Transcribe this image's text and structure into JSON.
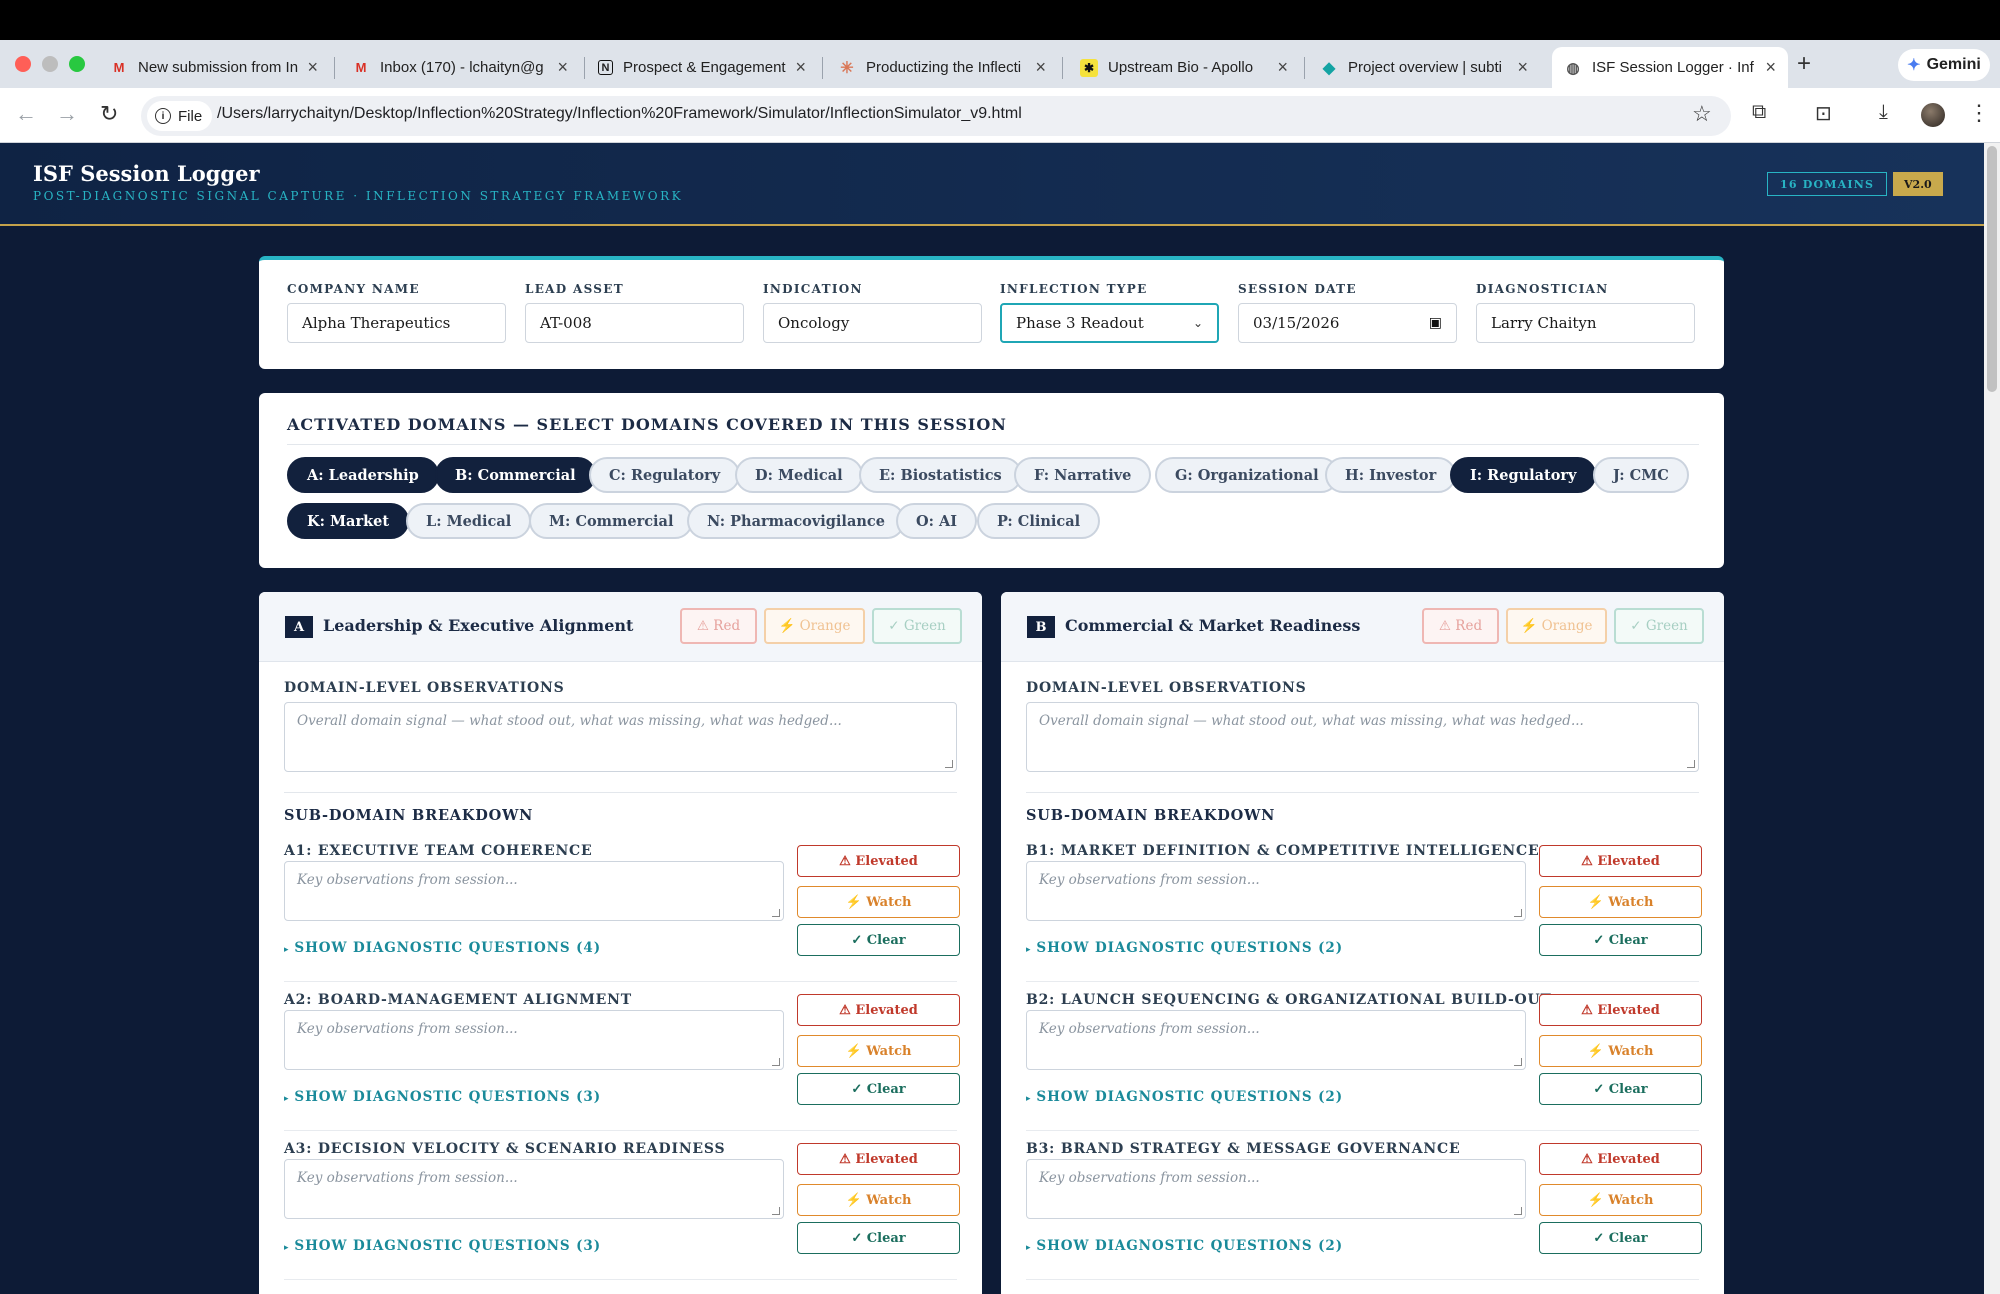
{
  "browser": {
    "tabs": [
      {
        "title": "New submission from In",
        "icon": "gmail-icon"
      },
      {
        "title": "Inbox (170) - lchaityn@g",
        "icon": "gmail-icon"
      },
      {
        "title": "Prospect & Engagement",
        "icon": "notion-icon"
      },
      {
        "title": "Productizing the Inflecti",
        "icon": "claude-icon"
      },
      {
        "title": "Upstream Bio - Apollo",
        "icon": "apollo-icon"
      },
      {
        "title": "Project overview | subti",
        "icon": "diamond-icon"
      },
      {
        "title": "ISF Session Logger · Inf",
        "icon": "globe-icon",
        "active": true
      }
    ],
    "gemini_label": "Gemini",
    "file_chip": "File",
    "url": "/Users/larrychaityn/Desktop/Inflection%20Strategy/Inflection%20Framework/Simulator/InflectionSimulator_v9.html"
  },
  "header": {
    "title": "ISF Session Logger",
    "subtitle": "POST-DIAGNOSTIC SIGNAL CAPTURE · INFLECTION STRATEGY FRAMEWORK",
    "domains_badge": "16 DOMAINS",
    "version_badge": "V2.0"
  },
  "meta": {
    "company_label": "COMPANY NAME",
    "company_value": "Alpha Therapeutics",
    "asset_label": "LEAD ASSET",
    "asset_value": "AT-008",
    "indication_label": "INDICATION",
    "indication_value": "Oncology",
    "inflection_label": "INFLECTION TYPE",
    "inflection_value": "Phase 3 Readout",
    "date_label": "SESSION DATE",
    "date_value": "03/15/2026",
    "diagnostician_label": "DIAGNOSTICIAN",
    "diagnostician_value": "Larry Chaityn"
  },
  "domains": {
    "title": "ACTIVATED DOMAINS — SELECT DOMAINS COVERED IN THIS SESSION",
    "chips": [
      {
        "label": "A: Leadership",
        "active": true
      },
      {
        "label": "B: Commercial",
        "active": true
      },
      {
        "label": "C: Regulatory",
        "active": false
      },
      {
        "label": "D: Medical",
        "active": false
      },
      {
        "label": "E: Biostatistics",
        "active": false
      },
      {
        "label": "F: Narrative",
        "active": false
      },
      {
        "label": "G: Organizational",
        "active": false
      },
      {
        "label": "H: Investor",
        "active": false
      },
      {
        "label": "I: Regulatory",
        "active": true
      },
      {
        "label": "J: CMC",
        "active": false
      },
      {
        "label": "K: Market",
        "active": true
      },
      {
        "label": "L: Medical",
        "active": false
      },
      {
        "label": "M: Commercial",
        "active": false
      },
      {
        "label": "N: Pharmacovigilance",
        "active": false
      },
      {
        "label": "O: AI",
        "active": false
      },
      {
        "label": "P: Clinical",
        "active": false
      }
    ]
  },
  "rag_labels": {
    "red": "⚠ Red",
    "orange": "⚡ Orange",
    "green": "✓ Green"
  },
  "common": {
    "obs_label": "DOMAIN-LEVEL OBSERVATIONS",
    "obs_placeholder": "Overall domain signal — what stood out, what was missing, what was hedged...",
    "sub_title": "SUB-DOMAIN BREAKDOWN",
    "sub_placeholder": "Key observations from session...",
    "elevated": "⚠ Elevated",
    "watch": "⚡ Watch",
    "clear": "✓ Clear"
  },
  "panels": [
    {
      "letter": "A",
      "name": "Leadership & Executive Alignment",
      "subs": [
        {
          "name": "A1: EXECUTIVE TEAM COHERENCE",
          "toggle": "SHOW DIAGNOSTIC QUESTIONS (4)"
        },
        {
          "name": "A2: BOARD-MANAGEMENT ALIGNMENT",
          "toggle": "SHOW DIAGNOSTIC QUESTIONS (3)"
        },
        {
          "name": "A3: DECISION VELOCITY & SCENARIO READINESS",
          "toggle": "SHOW DIAGNOSTIC QUESTIONS (3)"
        }
      ]
    },
    {
      "letter": "B",
      "name": "Commercial & Market Readiness",
      "subs": [
        {
          "name": "B1: MARKET DEFINITION & COMPETITIVE INTELLIGENCE",
          "toggle": "SHOW DIAGNOSTIC QUESTIONS (2)"
        },
        {
          "name": "B2: LAUNCH SEQUENCING & ORGANIZATIONAL BUILD-OUT",
          "toggle": "SHOW DIAGNOSTIC QUESTIONS (2)"
        },
        {
          "name": "B3: BRAND STRATEGY & MESSAGE GOVERNANCE",
          "toggle": "SHOW DIAGNOSTIC QUESTIONS (2)"
        }
      ]
    }
  ]
}
